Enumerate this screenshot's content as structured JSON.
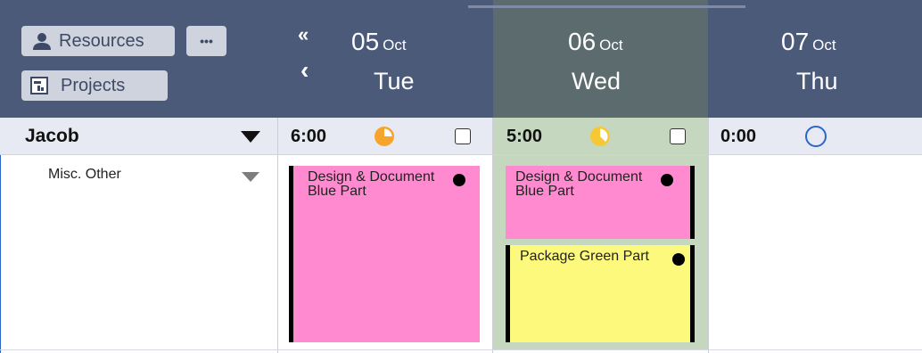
{
  "colors": {
    "header_bg": "#4b5a79",
    "header_today_bg": "#5c6b6e",
    "resource_row_bg": "#e7eaf2",
    "today_column_bg": "#c6d7bf",
    "task_pink": "#ff8ad0",
    "task_yellow": "#fdf97c",
    "accent_orange": "#f7a42d",
    "accent_yellow": "#f5c935",
    "accent_blue": "#2a66c9"
  },
  "toolbar": {
    "resources_label": "Resources",
    "more_label": "•••",
    "projects_label": "Projects",
    "nav_first": "«",
    "nav_prev": "‹"
  },
  "days": [
    {
      "day": "05",
      "month": "Oct",
      "weekday": "Tue",
      "hours": "6:00",
      "load_icon": "pie-three-quarter-icon"
    },
    {
      "day": "06",
      "month": "Oct",
      "weekday": "Wed",
      "hours": "5:00",
      "load_icon": "pie-five-eighths-icon"
    },
    {
      "day": "07",
      "month": "Oct",
      "weekday": "Thu",
      "hours": "0:00",
      "load_icon": "empty-circle-icon"
    }
  ],
  "resource": {
    "name": "Jacob"
  },
  "category": {
    "name": "Misc. Other"
  },
  "tasks": [
    {
      "title": "Design & Document Blue Part",
      "color": "pink",
      "day": "05"
    },
    {
      "title": "Design & Document Blue Part",
      "color": "pink",
      "day": "06"
    },
    {
      "title": "Package Green Part",
      "color": "yellow",
      "day": "06"
    }
  ]
}
